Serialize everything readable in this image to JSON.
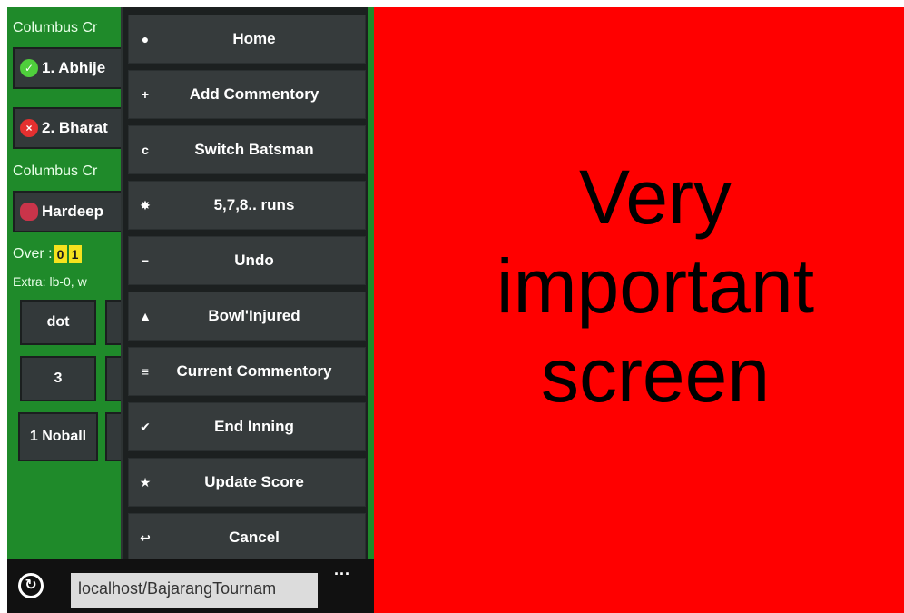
{
  "teams": {
    "batting_team": "Columbus Cr",
    "bowling_team": "Columbus Cr"
  },
  "batsmen": [
    {
      "label": "1. Abhije"
    },
    {
      "label": "2. Bharat"
    }
  ],
  "bowler": {
    "label": "Hardeep"
  },
  "over": {
    "label": "Over :",
    "balls": [
      "0",
      "1"
    ]
  },
  "extra": {
    "text": "Extra: lb-0, w"
  },
  "score_buttons": [
    "dot",
    "3",
    "1 Noball"
  ],
  "menu": {
    "items": [
      {
        "icon": "home-icon",
        "glyph": "●",
        "label": "Home"
      },
      {
        "icon": "plus-icon",
        "glyph": "+",
        "label": "Add Commentory"
      },
      {
        "icon": "refresh-icon",
        "glyph": "c",
        "label": "Switch Batsman"
      },
      {
        "icon": "gear-icon",
        "glyph": "✸",
        "label": "5,7,8.. runs"
      },
      {
        "icon": "minus-icon",
        "glyph": "−",
        "label": "Undo"
      },
      {
        "icon": "warning-icon",
        "glyph": "▲",
        "label": "Bowl'Injured"
      },
      {
        "icon": "list-icon",
        "glyph": "≡",
        "label": "Current Commentory"
      },
      {
        "icon": "check-icon",
        "glyph": "✔",
        "label": "End Inning"
      },
      {
        "icon": "star-icon",
        "glyph": "★",
        "label": "Update Score"
      },
      {
        "icon": "back-icon",
        "glyph": "↩",
        "label": "Cancel"
      }
    ]
  },
  "appbar": {
    "address": "localhost/BajarangTournam",
    "more": "..."
  },
  "overlay": {
    "lines": [
      "Very",
      "important",
      "screen"
    ],
    "background": "#ff0000"
  }
}
